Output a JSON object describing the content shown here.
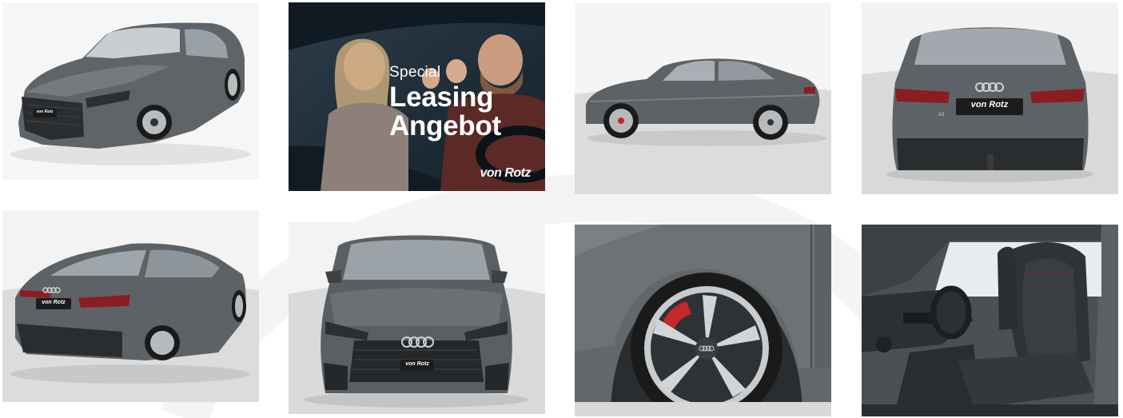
{
  "gallery": {
    "images": [
      {
        "name": "front-three-quarter-view"
      },
      {
        "name": "special-leasing-offer-banner"
      },
      {
        "name": "side-profile-view"
      },
      {
        "name": "rear-view"
      },
      {
        "name": "rear-three-quarter-view"
      },
      {
        "name": "front-view"
      },
      {
        "name": "wheel-detail"
      },
      {
        "name": "interior-seats"
      }
    ]
  },
  "promo": {
    "line1": "Special",
    "line2": "Leasing",
    "line3": "Angebot",
    "brand": "von Rotz"
  },
  "plates": {
    "rear": "von Rotz",
    "rear_small": "von Rotz",
    "front": "von Rotz",
    "front34": "von Rotz",
    "badge_model": "A3"
  },
  "colors": {
    "car_body": "#5c6164",
    "car_shadow": "#3a3e41",
    "studio_bg": "#ececec",
    "promo_bg": "#1b2a35",
    "brake_caliper": "#c4282c",
    "taillight": "#8b1d22"
  }
}
